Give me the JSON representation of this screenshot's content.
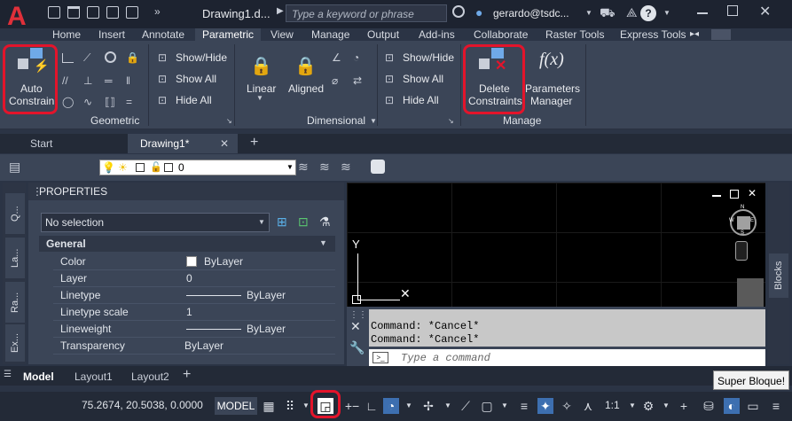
{
  "app": {
    "logo": "A",
    "doc_title": "Drawing1.d...",
    "search_placeholder": "Type a keyword or phrase",
    "user": "gerardo@tsdc...",
    "help": "?"
  },
  "ribbon_tabs": [
    "Home",
    "Insert",
    "Annotate",
    "Parametric",
    "View",
    "Manage",
    "Output",
    "Add-ins",
    "Collaborate",
    "Raster Tools",
    "Express Tools"
  ],
  "ribbon": {
    "auto_constrain": [
      "Auto",
      "Constrain"
    ],
    "geo_show_hide": "Show/Hide",
    "geo_show_all": "Show All",
    "geo_hide_all": "Hide All",
    "linear": "Linear",
    "aligned": "Aligned",
    "dim_show_hide": "Show/Hide",
    "dim_show_all": "Show All",
    "dim_hide_all": "Hide All",
    "delete_constraints": [
      "Delete",
      "Constraints"
    ],
    "parameters_manager": [
      "Parameters",
      "Manager"
    ],
    "group_geometric": "Geometric",
    "group_dimensional": "Dimensional",
    "group_manage": "Manage"
  },
  "doc_tabs": {
    "start": "Start",
    "drawing": "Drawing1*",
    "close": "✕",
    "add": "+"
  },
  "layer": {
    "name": "0"
  },
  "properties": {
    "title": "PROPERTIES",
    "selection": "No selection",
    "section": "General",
    "rows": [
      {
        "key": "Color",
        "value": "ByLayer"
      },
      {
        "key": "Layer",
        "value": "0"
      },
      {
        "key": "Linetype",
        "value": "ByLayer"
      },
      {
        "key": "Linetype scale",
        "value": "1"
      },
      {
        "key": "Lineweight",
        "value": "ByLayer"
      },
      {
        "key": "Transparency",
        "value": "ByLayer"
      }
    ],
    "side_tabs": [
      "Q...",
      "La...",
      "Ra...",
      "Ex..."
    ]
  },
  "canvas": {
    "y_axis": "Y",
    "close": "✕",
    "compass": {
      "n": "N",
      "s": "S",
      "e": "E",
      "w": "W"
    }
  },
  "command": {
    "history": [
      "Command: *Cancel*",
      "Command: *Cancel*"
    ],
    "placeholder": "Type a command"
  },
  "blocks_tab": "Blocks",
  "layout_tabs": [
    "Model",
    "Layout1",
    "Layout2"
  ],
  "tooltip": "Super Bloque!",
  "status": {
    "coords": "75.2674, 20.5038, 0.0000",
    "model": "MODEL",
    "scale": "1:1"
  }
}
